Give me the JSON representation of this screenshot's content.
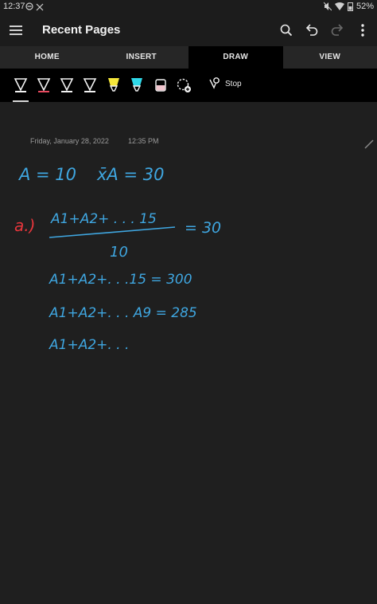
{
  "status_bar": {
    "time": "12:37",
    "battery": "52%"
  },
  "app_bar": {
    "title": "Recent Pages"
  },
  "tabs": [
    {
      "label": "HOME",
      "active": false
    },
    {
      "label": "INSERT",
      "active": false
    },
    {
      "label": "DRAW",
      "active": true
    },
    {
      "label": "VIEW",
      "active": false
    }
  ],
  "toolbar": {
    "pens": [
      {
        "name": "pen-white",
        "color": "#f2f2f2"
      },
      {
        "name": "pen-red",
        "color": "#e84a5f"
      },
      {
        "name": "pen-white-2",
        "color": "#f2f2f2"
      },
      {
        "name": "pen-white-3",
        "color": "#f2f2f2"
      },
      {
        "name": "highlighter-yellow",
        "color": "#f5e63a"
      },
      {
        "name": "highlighter-cyan",
        "color": "#2fd8e8"
      },
      {
        "name": "highlighter-pink",
        "color": "#f2c6cf"
      }
    ],
    "stop_label": "Stop"
  },
  "page": {
    "date": "Friday, January 28, 2022",
    "time": "12:35 PM"
  },
  "ink": {
    "colors": {
      "blue": "#3fa6e0",
      "red": "#e8363c"
    },
    "lines": [
      {
        "text": "A = 10"
      },
      {
        "text": "x̄A = 30"
      },
      {
        "text": "a.)"
      },
      {
        "text": "A1+A2+ . . . 15"
      },
      {
        "text": "10"
      },
      {
        "text": "= 30"
      },
      {
        "text": "A1+A2+. . .15 = 300"
      },
      {
        "text": "A1+A2+. . . A9 = 285"
      },
      {
        "text": "A1+A2+. . ."
      }
    ]
  }
}
